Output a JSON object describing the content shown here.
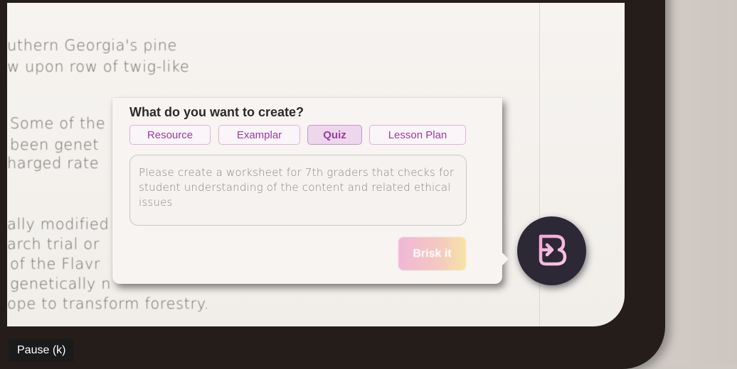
{
  "document": {
    "lines": [
      "uthern Georgia's pine",
      "w upon row of twig-like",
      "Some of the",
      "been genet",
      "harged rate",
      "ally modified",
      "arch trial or",
      "of the Flavr",
      "genetically n",
      "ope to transform forestry."
    ]
  },
  "popup": {
    "title": "What do you want to create?",
    "options": [
      "Resource",
      "Examplar",
      "Quiz",
      "Lesson Plan"
    ],
    "selected": "Quiz",
    "prompt_value": "Please create a worksheet for 7th graders that checks for student understanding of the content and related ethical issues",
    "submit_label": "Brisk it"
  },
  "fab": {
    "icon": "brisk-logo-icon"
  },
  "player": {
    "tooltip": "Pause (k)"
  },
  "colors": {
    "accent": "#9a3c9b",
    "fab_bg": "#2c2836",
    "bezel": "#241d19"
  }
}
